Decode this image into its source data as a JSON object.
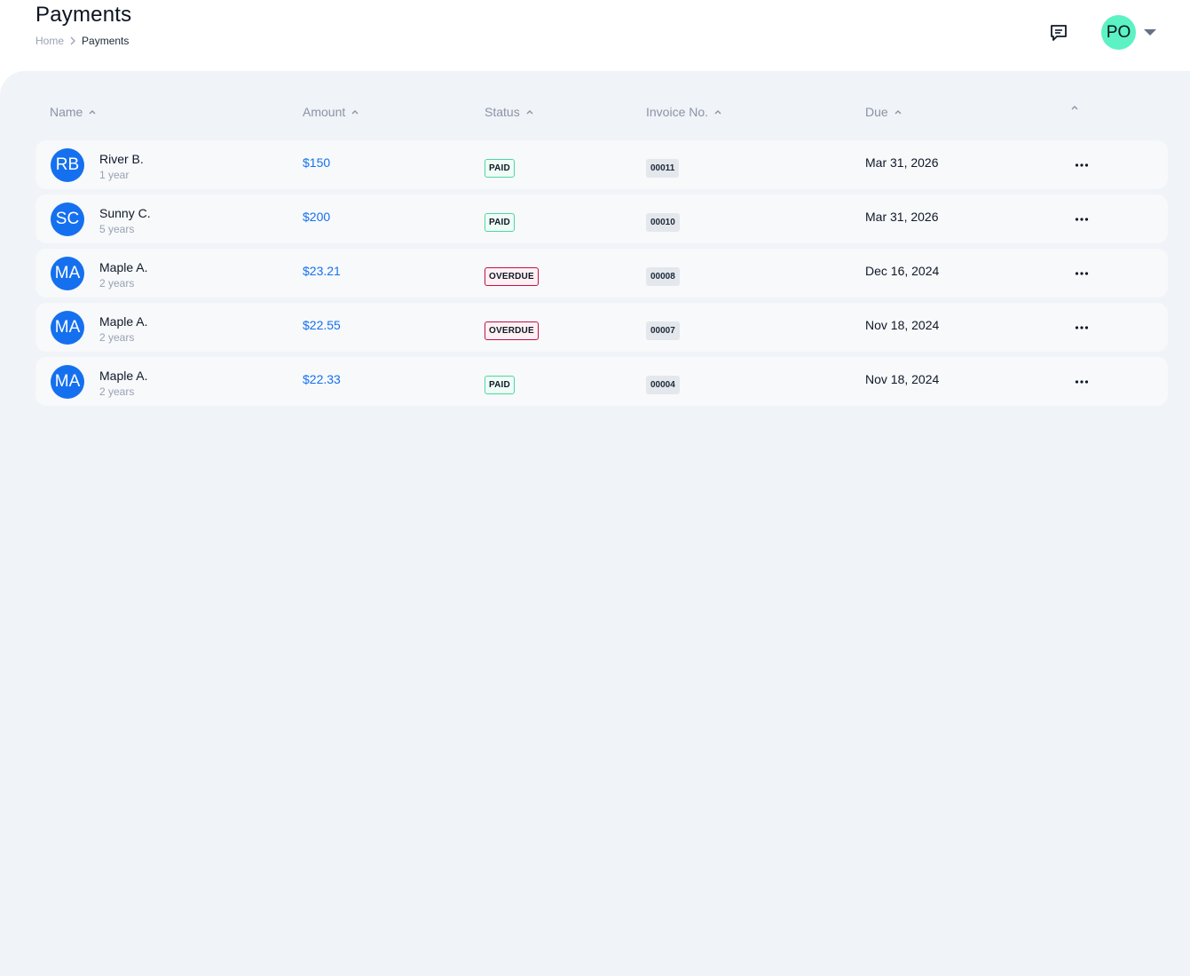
{
  "header": {
    "title": "Payments",
    "breadcrumb": {
      "home": "Home",
      "current": "Payments"
    },
    "user_initials": "PO"
  },
  "colors": {
    "accent": "#1570ef",
    "user_avatar": "#5cf2c3",
    "paid_border": "#4fd6a4",
    "overdue_border": "#c01048",
    "panel_bg": "#f0f3f7"
  },
  "table": {
    "columns": [
      "Name",
      "Amount",
      "Status",
      "Invoice No.",
      "Due",
      ""
    ],
    "rows": [
      {
        "initials": "RB",
        "name": "River B.",
        "tenure": "1 year",
        "amount": "$150",
        "status": "PAID",
        "invoice": "00011",
        "due": "Mar 31, 2026"
      },
      {
        "initials": "SC",
        "name": "Sunny C.",
        "tenure": "5 years",
        "amount": "$200",
        "status": "PAID",
        "invoice": "00010",
        "due": "Mar 31, 2026"
      },
      {
        "initials": "MA",
        "name": "Maple A.",
        "tenure": "2 years",
        "amount": "$23.21",
        "status": "OVERDUE",
        "invoice": "00008",
        "due": "Dec 16, 2024"
      },
      {
        "initials": "MA",
        "name": "Maple A.",
        "tenure": "2 years",
        "amount": "$22.55",
        "status": "OVERDUE",
        "invoice": "00007",
        "due": "Nov 18, 2024"
      },
      {
        "initials": "MA",
        "name": "Maple A.",
        "tenure": "2 years",
        "amount": "$22.33",
        "status": "PAID",
        "invoice": "00004",
        "due": "Nov 18, 2024"
      }
    ]
  }
}
